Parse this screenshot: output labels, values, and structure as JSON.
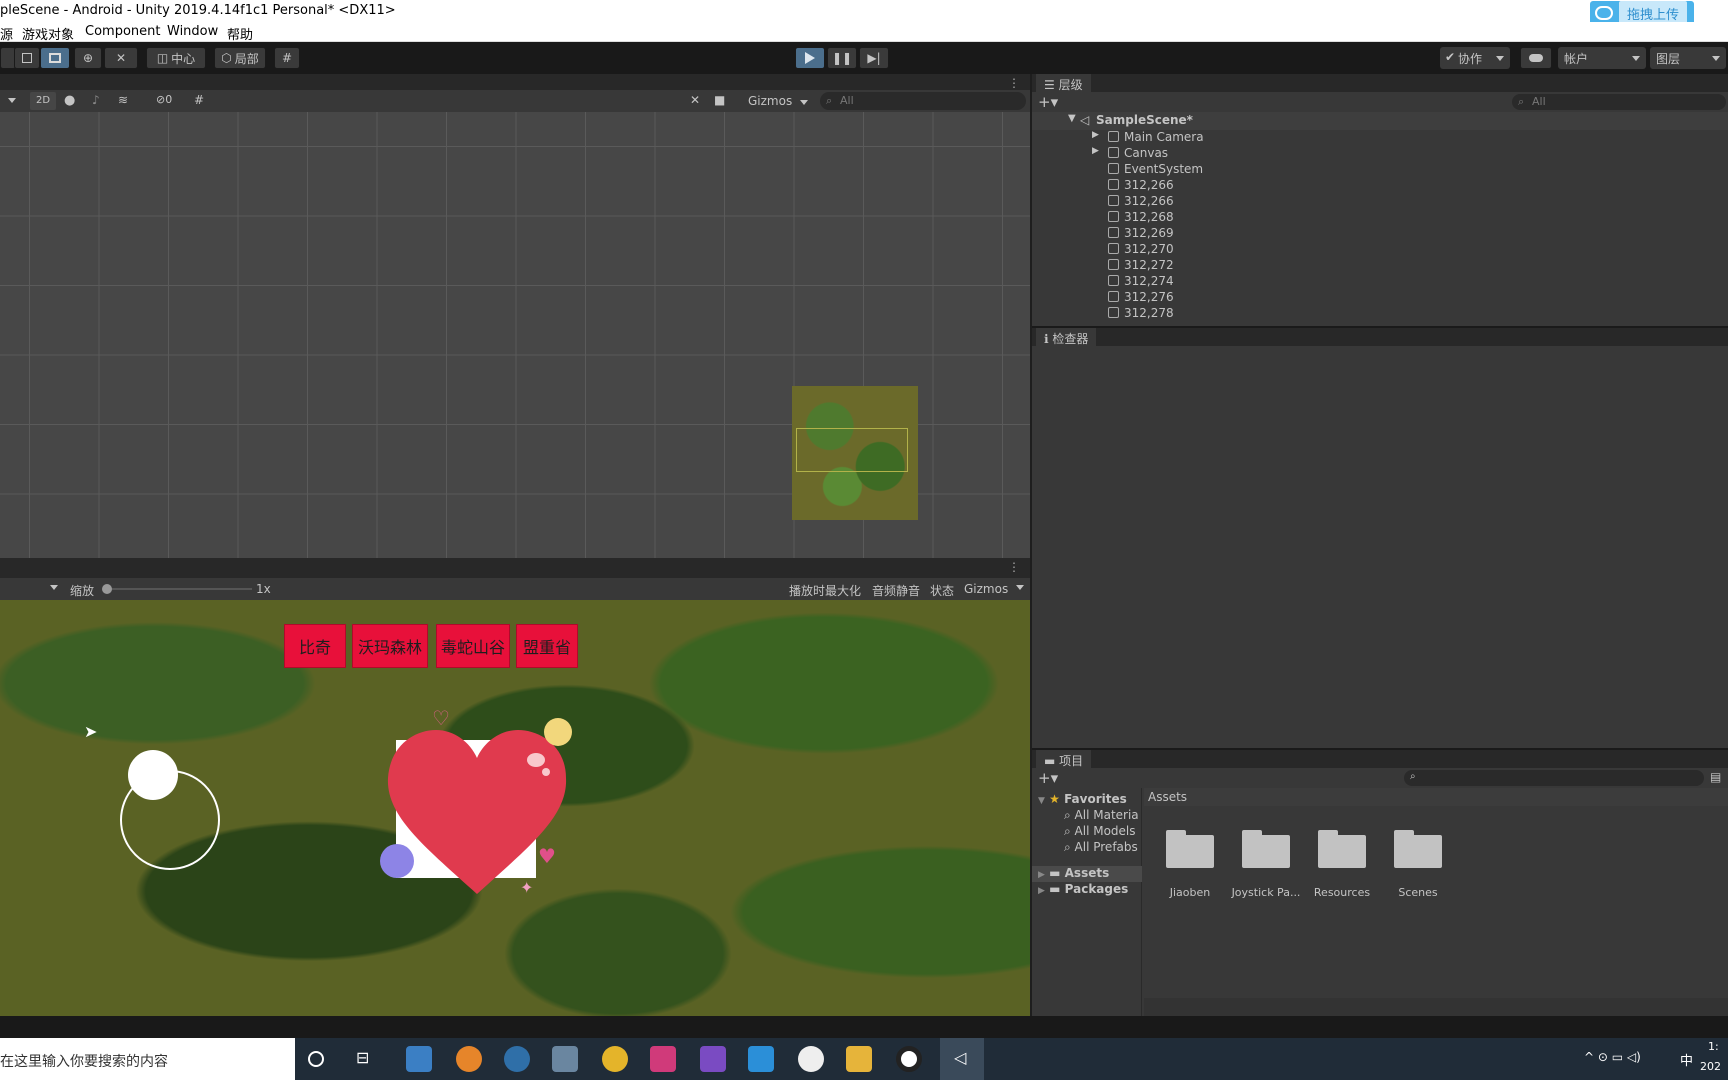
{
  "window": {
    "title": "pleScene - Android - Unity 2019.4.14f1c1 Personal* <DX11>",
    "upload_label": "拖拽上传"
  },
  "menu": {
    "items": [
      "源",
      "游戏对象",
      "Component",
      "Window",
      "帮助"
    ]
  },
  "toolbar": {
    "pivot_center": "中心",
    "pivot_local": "局部",
    "play_icon": "play-icon",
    "pause_icon": "pause-icon",
    "step_icon": "step-icon",
    "collab": "协作",
    "account": "帐户",
    "layers": "图层"
  },
  "scene": {
    "mode_2d": "2D",
    "hidden_count": "0",
    "gizmos": "Gizmos",
    "search_placeholder": "All"
  },
  "game": {
    "scale_label": "缩放",
    "scale_value": "1x",
    "maximize_on_play": "播放时最大化",
    "mute_audio": "音频静音",
    "stats": "状态",
    "gizmos": "Gizmos",
    "buttons": [
      "比奇",
      "沃玛森林",
      "毒蛇山谷",
      "盟重省"
    ]
  },
  "hierarchy": {
    "tab": "层级",
    "search_placeholder": "All",
    "scene_name": "SampleScene*",
    "items": [
      "Main Camera",
      "Canvas",
      "EventSystem",
      "312,266",
      "312,266",
      "312,268",
      "312,269",
      "312,270",
      "312,272",
      "312,274",
      "312,276",
      "312,278"
    ]
  },
  "inspector": {
    "tab": "检查器"
  },
  "project": {
    "tab": "项目",
    "favorites": "Favorites",
    "favorite_items": [
      "All Materia",
      "All Models",
      "All Prefabs"
    ],
    "tree": [
      "Assets",
      "Packages"
    ],
    "breadcrumb": "Assets",
    "folders": [
      "Jiaoben",
      "Joystick Pa...",
      "Resources",
      "Scenes"
    ]
  },
  "taskbar": {
    "search_text": "在这里输入你要搜索的内容",
    "ime": "中",
    "clock_time": "1:",
    "clock_date": "202"
  },
  "colors": {
    "accent": "#4b6e8c",
    "game_button": "#e8103a",
    "heart": "#e03a4e"
  }
}
